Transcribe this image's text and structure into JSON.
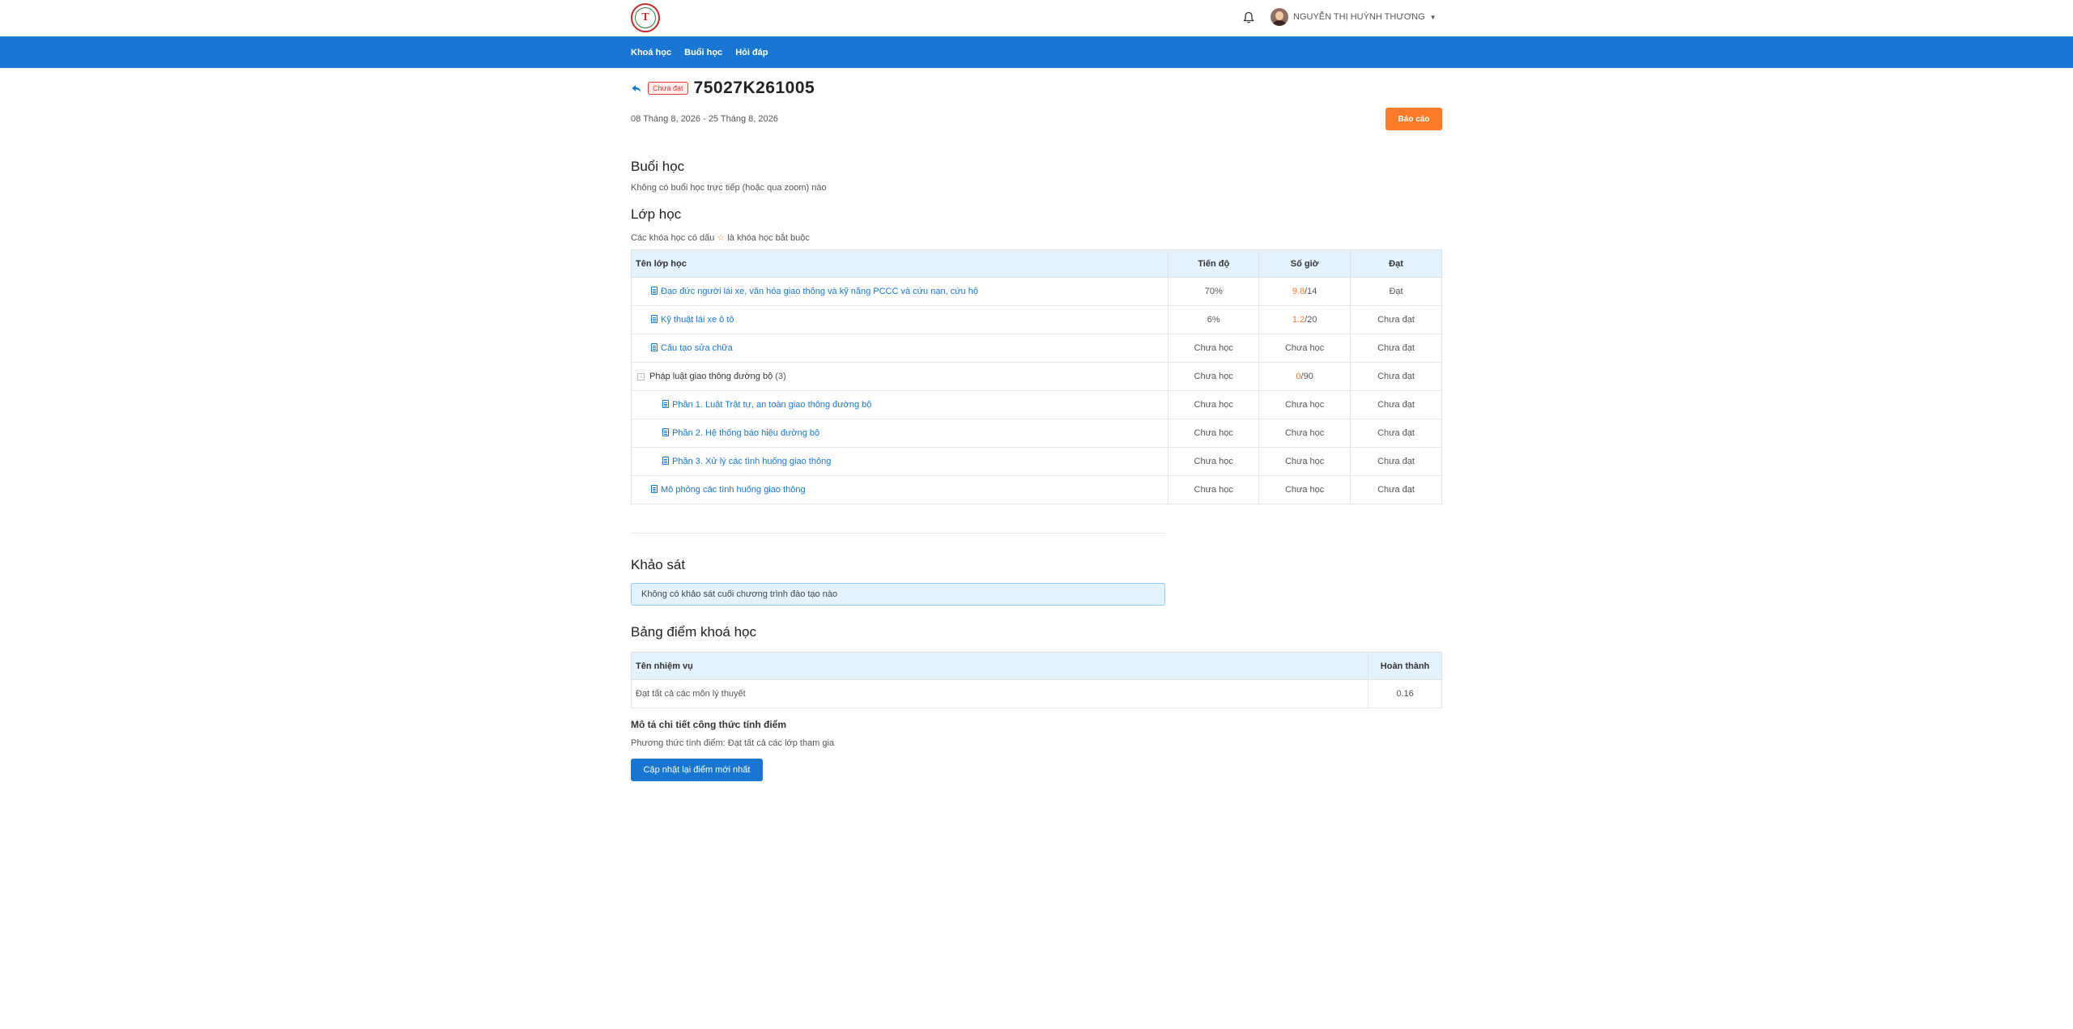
{
  "header": {
    "logo_text": "T",
    "user_name": "NGUYỄN THỊ HUỲNH THƯƠNG"
  },
  "nav": {
    "items": [
      {
        "label": "Khoá học"
      },
      {
        "label": "Buổi học"
      },
      {
        "label": "Hỏi đáp"
      }
    ]
  },
  "course": {
    "status_badge": "Chưa đạt",
    "code": "75027K261005",
    "dates": "08 Tháng 8, 2026 - 25 Tháng 8, 2026",
    "report_label": "Báo cáo"
  },
  "sessions": {
    "title": "Buổi học",
    "empty_text": "Không có buổi học trực tiếp (hoặc qua zoom) nào"
  },
  "classes": {
    "title": "Lớp học",
    "note_before": "Các khóa học có dấu",
    "note_star": "☆",
    "note_after": "là khóa học bắt buộc",
    "headers": {
      "name": "Tên lớp học",
      "progress": "Tiến độ",
      "hours": "Số giờ",
      "pass": "Đạt"
    },
    "rows": [
      {
        "name": "Đạo đức người lái xe, văn hóa giao thông và kỹ năng PCCC và cứu nạn, cứu hộ",
        "progress": "70%",
        "hours_done": "9.8",
        "hours_sep": "/",
        "hours_total": "14",
        "pass": "Đạt"
      },
      {
        "name": "Kỹ thuật lái xe ô tô",
        "progress": "6%",
        "hours_done": "1.2",
        "hours_sep": "/",
        "hours_total": "20",
        "pass": "Chưa đạt"
      },
      {
        "name": "Cấu tạo sửa chữa",
        "progress": "Chưa học",
        "hours": "Chưa học",
        "pass": "Chưa đạt"
      },
      {
        "name": "Pháp luật giao thông đường bộ",
        "count": "(3)",
        "collapse": "-",
        "progress": "Chưa học",
        "hours_done": "0",
        "hours_sep": "/",
        "hours_total": "90",
        "pass": "Chưa đạt"
      },
      {
        "name": "Phần 1. Luật Trật tự, an toàn giao thông đường bộ",
        "progress": "Chưa học",
        "hours": "Chưa học",
        "pass": "Chưa đạt"
      },
      {
        "name": "Phần 2. Hệ thống báo hiệu đường bộ",
        "progress": "Chưa học",
        "hours": "Chưa học",
        "pass": "Chưa đạt"
      },
      {
        "name": "Phần 3. Xử lý các tình huống giao thông",
        "progress": "Chưa học",
        "hours": "Chưa học",
        "pass": "Chưa đạt"
      },
      {
        "name": "Mô phỏng các tình huống giao thông",
        "progress": "Chưa học",
        "hours": "Chưa học",
        "pass": "Chưa đạt"
      }
    ]
  },
  "survey": {
    "title": "Khảo sát",
    "empty_text": "Không có khảo sát cuối chương trình đào tạo nào"
  },
  "scoreboard": {
    "title": "Bảng điểm khoá học",
    "headers": {
      "task": "Tên nhiệm vụ",
      "complete": "Hoàn thành"
    },
    "rows": [
      {
        "task": "Đạt tất cả các môn lý thuyết",
        "complete": "0.16"
      }
    ],
    "formula_title": "Mô tả chi tiết công thức tính điểm",
    "formula_text": "Phương thức tính điểm: Đạt tất cả các lớp tham gia",
    "update_label": "Cập nhật lại điểm mới nhất"
  },
  "colors": {
    "primary": "#1976d2",
    "accent_orange": "#ff7a29",
    "fail_red": "#e53935",
    "header_bg": "#e3f2fd"
  },
  "icons": [
    "logo",
    "bell-icon",
    "avatar",
    "back-arrow-icon",
    "document-icon",
    "collapse-icon",
    "caret-down-icon"
  ]
}
